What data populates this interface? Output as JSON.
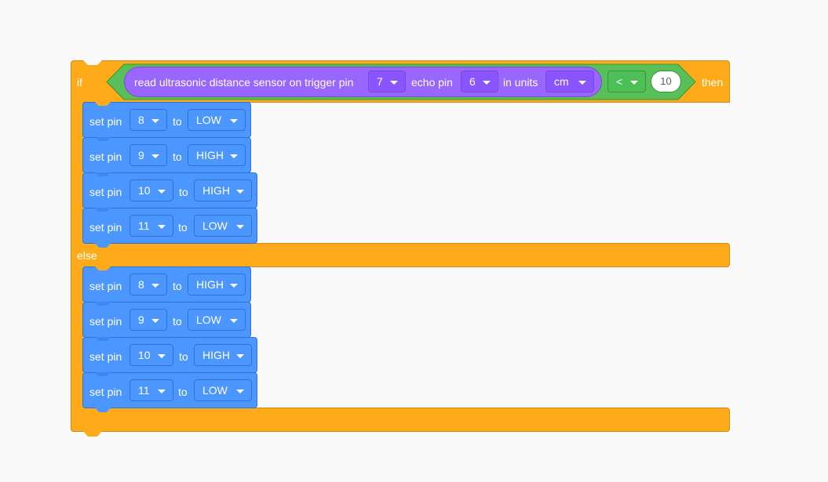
{
  "if_block": {
    "if_label": "if",
    "then_label": "then",
    "else_label": "else",
    "condition": {
      "reporter_text": "read ultrasonic distance sensor on trigger pin",
      "trigger_pin": "7",
      "echo_label": "echo pin",
      "echo_pin": "6",
      "units_label": "in units",
      "units": "cm",
      "operator": "<",
      "value": "10"
    },
    "then_blocks": [
      {
        "set_label": "set pin",
        "pin": "8",
        "to_label": "to",
        "state": "LOW"
      },
      {
        "set_label": "set pin",
        "pin": "9",
        "to_label": "to",
        "state": "HIGH"
      },
      {
        "set_label": "set pin",
        "pin": "10",
        "to_label": "to",
        "state": "HIGH"
      },
      {
        "set_label": "set pin",
        "pin": "11",
        "to_label": "to",
        "state": "LOW"
      }
    ],
    "else_blocks": [
      {
        "set_label": "set pin",
        "pin": "8",
        "to_label": "to",
        "state": "HIGH"
      },
      {
        "set_label": "set pin",
        "pin": "9",
        "to_label": "to",
        "state": "LOW"
      },
      {
        "set_label": "set pin",
        "pin": "10",
        "to_label": "to",
        "state": "HIGH"
      },
      {
        "set_label": "set pin",
        "pin": "11",
        "to_label": "to",
        "state": "LOW"
      }
    ]
  },
  "colors": {
    "control": "#ffab19",
    "operator": "#59c059",
    "sensor": "#9966ff",
    "pins": "#4c97ff",
    "workspace": "#f9f9f9"
  }
}
